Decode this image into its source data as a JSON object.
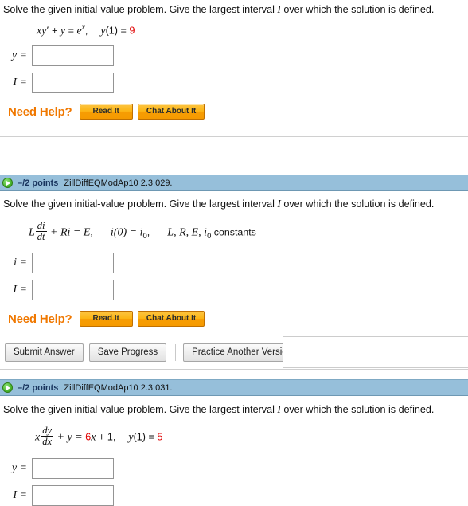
{
  "colors": {
    "header_bar": "#96bfda",
    "points_text": "#19355e",
    "need_help_orange": "#f07800",
    "help_button_orange": "#fcb514",
    "equation_red": "#e00000"
  },
  "problems": [
    {
      "id": "problem-1",
      "prompt_part1": "Solve the given initial-value problem. Give the largest interval ",
      "prompt_italic_I": "I",
      "prompt_part2": " over which the solution is defined.",
      "equation": {
        "lhs_x": "x",
        "lhs_yprime": "y",
        "prime": "′",
        "plus": " + ",
        "y": "y",
        "equals": " = ",
        "e": "e",
        "exp": "x",
        "comma": ",",
        "initial_y": "y",
        "initial_arg": "(1) = ",
        "initial_value": "9"
      },
      "fields": [
        {
          "label": "y",
          "eq": "=",
          "value": "",
          "placeholder": ""
        },
        {
          "label": "I",
          "eq": "=",
          "value": "",
          "placeholder": ""
        }
      ],
      "need_help": {
        "label": "Need Help?",
        "read_it": "Read It",
        "chat_about_it": "Chat About It"
      }
    },
    {
      "id": "problem-2",
      "header": {
        "icon": "expand-green-arrow-icon",
        "points": "–/2 points",
        "question_code": "ZillDiffEQModAp10 2.3.029."
      },
      "prompt_part1": "Solve the given initial-value problem. Give the largest interval ",
      "prompt_italic_I": "I",
      "prompt_part2": " over which the solution is defined.",
      "equation": {
        "L": "L",
        "frac_top": "di",
        "frac_bot": "dt",
        "plus_Ri": " + Ri = E,",
        "initial": "i(0) = i",
        "initial_sub": "0",
        "initial_comma": ",",
        "constants_list": "L, R, E, i",
        "constants_sub": "0",
        "constants_word": " constants"
      },
      "fields": [
        {
          "label": "i",
          "eq": "=",
          "value": "",
          "placeholder": ""
        },
        {
          "label": "I",
          "eq": "=",
          "value": "",
          "placeholder": ""
        }
      ],
      "need_help": {
        "label": "Need Help?",
        "read_it": "Read It",
        "chat_about_it": "Chat About It"
      }
    },
    {
      "id": "problem-3",
      "header": {
        "icon": "expand-green-arrow-icon",
        "points": "–/2 points",
        "question_code": "ZillDiffEQModAp10 2.3.031."
      },
      "prompt_part1": "Solve the given initial-value problem. Give the largest interval ",
      "prompt_italic_I": "I",
      "prompt_part2": " over which the solution is defined.",
      "equation": {
        "x": "x",
        "frac_top": "dy",
        "frac_bot": "dx",
        "plus_y": " + y = ",
        "coefficient": "6",
        "x2": "x",
        "plus_one": " + 1,",
        "initial_y": "y",
        "initial_arg": "(1) = ",
        "initial_value": "5"
      },
      "fields": [
        {
          "label": "y",
          "eq": "=",
          "value": "",
          "placeholder": ""
        },
        {
          "label": "I",
          "eq": "=",
          "value": "",
          "placeholder": ""
        }
      ]
    }
  ],
  "submit_row": {
    "submit_answer": "Submit Answer",
    "save_progress": "Save Progress",
    "practice_another_version": "Practice Another Version"
  }
}
